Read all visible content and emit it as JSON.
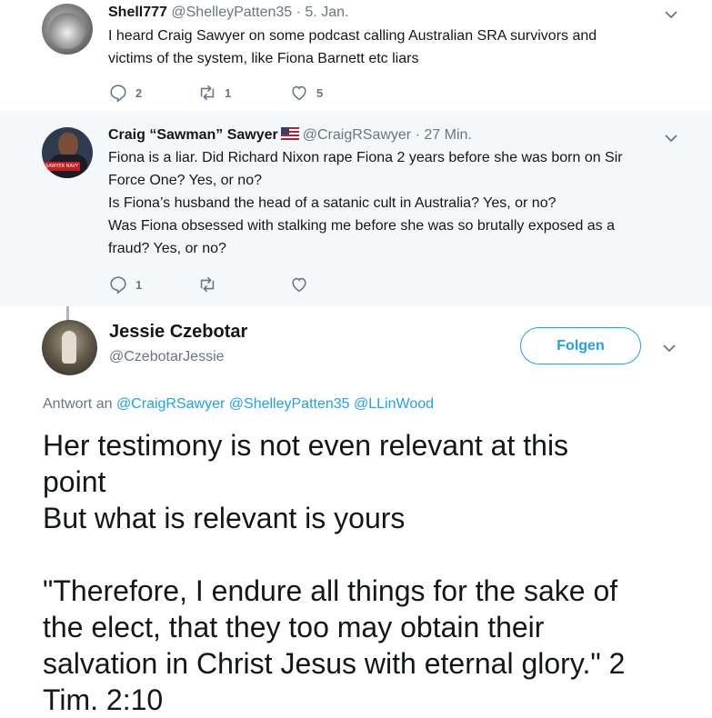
{
  "tweets": [
    {
      "name": "Shell777",
      "handle": "@ShelleyPatten35",
      "separator": "·",
      "time": "5. Jan.",
      "lines": [
        "I heard  Craig Sawyer on some podcast calling Australian SRA survivors and",
        "victims of the system, like Fiona Barnett etc liars"
      ],
      "reply_count": "2",
      "retweet_count": "1",
      "like_count": "5"
    },
    {
      "name": "Craig “Sawman” Sawyer",
      "flag": "us-flag-icon",
      "handle": "@CraigRSawyer",
      "separator": "·",
      "time": "27 Min.",
      "avatar_banner": "SAWYER NAVY SEAL",
      "lines": [
        "Fiona is a liar. Did Richard Nixon rape Fiona 2 years before she was born on Sir",
        "Force One? Yes, or no?",
        "Is Fiona’s husband the head of a satanic cult in Australia? Yes, or no?",
        "Was Fiona obsessed with stalking me before she was so brutally exposed as a",
        "fraud? Yes, or no?"
      ],
      "reply_count": "1",
      "retweet_count": "",
      "like_count": ""
    }
  ],
  "main_tweet": {
    "name": "Jessie Czebotar",
    "handle": "@CzebotarJessie",
    "follow_label": "Folgen",
    "reply_prefix": "Antwort an",
    "reply_handles": [
      "@CraigRSawyer",
      "@ShelleyPatten35",
      "@LLinWood"
    ],
    "lines": [
      "Her testimony is not even relevant at this",
      "point",
      "But what is relevant is yours",
      "",
      "\"Therefore, I endure all things for the sake of",
      "the elect, that they too may obtain their",
      "salvation in Christ Jesus with eternal glory.\" 2",
      "Tim. 2:10"
    ]
  },
  "colors": {
    "link": "#1da1f2",
    "muted": "#657786",
    "thread_line": "#aab8c2",
    "highlight_bg": "#f5f8fa"
  }
}
